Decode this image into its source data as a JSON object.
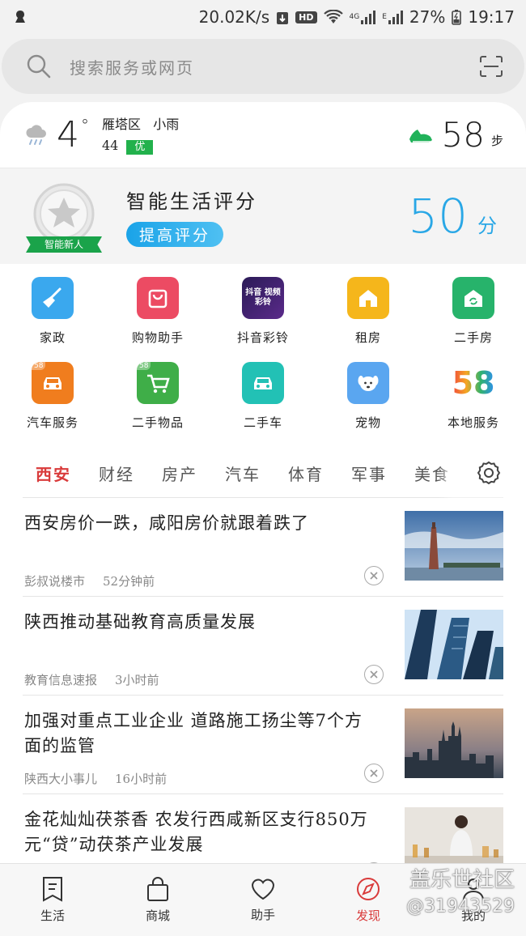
{
  "status_bar": {
    "speed": "20.02K/s",
    "hd": "HD",
    "net1": "4G",
    "net2": "E",
    "battery": "27%",
    "time": "19:17"
  },
  "search": {
    "placeholder": "搜索服务或网页"
  },
  "weather": {
    "temp": "4",
    "degree": "°",
    "district": "雁塔区",
    "condition": "小雨",
    "aqi_value": "44",
    "aqi_level": "优",
    "steps": "58",
    "steps_unit": "步"
  },
  "score": {
    "badge_label": "智能新人",
    "title": "智能生活评分",
    "button": "提高评分",
    "value": "50",
    "unit": "分"
  },
  "services": [
    {
      "label": "家政",
      "icon": "broom-icon",
      "color": "#3aa8ee"
    },
    {
      "label": "购物助手",
      "icon": "shopping-bag-icon",
      "color": "#ec4b63"
    },
    {
      "label": "抖音彩铃",
      "icon": "douyin-ringtone-icon",
      "color": "#2b1b57",
      "icon_text": "抖音 视频彩铃"
    },
    {
      "label": "租房",
      "icon": "house-icon",
      "color": "#f5b61b"
    },
    {
      "label": "二手房",
      "icon": "secondhand-house-icon",
      "color": "#27b36b"
    },
    {
      "label": "汽车服务",
      "icon": "car-icon",
      "color": "#f07d1e",
      "tag": "58"
    },
    {
      "label": "二手物品",
      "icon": "cart-icon",
      "color": "#3fae48",
      "tag": "58"
    },
    {
      "label": "二手车",
      "icon": "car-icon",
      "color": "#22c1b5"
    },
    {
      "label": "宠物",
      "icon": "dog-icon",
      "color": "#5aa6f0"
    },
    {
      "label": "本地服务",
      "icon": "58-logo-icon",
      "color": "#ffffff",
      "icon_text": "58"
    }
  ],
  "tabs": [
    "西安",
    "财经",
    "房产",
    "汽车",
    "体育",
    "军事",
    "美食"
  ],
  "news": [
    {
      "title": "西安房价一跌，咸阳房价就跟着跌了",
      "source": "彭叔说楼市",
      "time": "52分钟前",
      "thumb": "tower-over-water"
    },
    {
      "title": "陕西推动基础教育高质量发展",
      "source": "教育信息速报",
      "time": "3小时前",
      "thumb": "skyscrapers"
    },
    {
      "title": "加强对重点工业企业 道路施工扬尘等7个方面的监管",
      "source": "陕西大小事儿",
      "time": "16小时前",
      "thumb": "city-skyline"
    },
    {
      "title": "金花灿灿茯茶香 农发行西咸新区支行850万元“贷”动茯茶产业发展",
      "source": "",
      "time": "",
      "thumb": "lab-worker"
    }
  ],
  "bottom_nav": [
    {
      "label": "生活",
      "icon": "bookmark-icon"
    },
    {
      "label": "商城",
      "icon": "bag-icon"
    },
    {
      "label": "助手",
      "icon": "heart-icon"
    },
    {
      "label": "发现",
      "icon": "compass-icon",
      "active": true
    },
    {
      "label": "我的",
      "icon": "person-icon"
    }
  ],
  "watermark": {
    "line1": "盖乐世社区",
    "line2": "@31943529"
  },
  "colors": {
    "accent_red": "#d93b3b",
    "score_blue": "#29a7e6",
    "aqi_green": "#22b14c"
  }
}
